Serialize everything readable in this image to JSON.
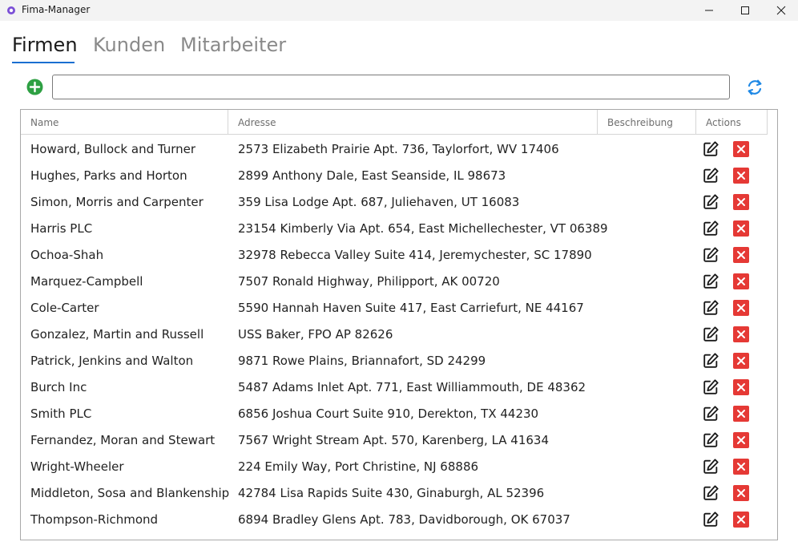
{
  "window": {
    "title": "Fima-Manager",
    "controls": [
      "minimize-icon",
      "maximize-icon",
      "close-icon"
    ]
  },
  "tabs": [
    {
      "label": "Firmen",
      "active": true
    },
    {
      "label": "Kunden",
      "active": false
    },
    {
      "label": "Mitarbeiter",
      "active": false
    }
  ],
  "toolbar": {
    "add_icon": "plus-circle-icon",
    "search_value": "",
    "refresh_icon": "refresh-icon"
  },
  "colors": {
    "accent": "#1a6fd1",
    "add": "#2ea043",
    "delete": "#e53935",
    "refresh": "#1e88e5"
  },
  "table": {
    "columns": [
      "Name",
      "Adresse",
      "Beschreibung",
      "Actions"
    ],
    "rows": [
      {
        "name": "Howard, Bullock and Turner",
        "address": "2573 Elizabeth Prairie Apt. 736, Taylorfort, WV 17406",
        "description": ""
      },
      {
        "name": "Hughes, Parks and Horton",
        "address": "2899 Anthony Dale, East Seanside, IL 98673",
        "description": ""
      },
      {
        "name": "Simon, Morris and Carpenter",
        "address": "359 Lisa Lodge Apt. 687, Juliehaven, UT 16083",
        "description": ""
      },
      {
        "name": "Harris PLC",
        "address": "23154 Kimberly Via Apt. 654, East Michellechester, VT 06389",
        "description": ""
      },
      {
        "name": "Ochoa-Shah",
        "address": "32978 Rebecca Valley Suite 414, Jeremychester, SC 17890",
        "description": ""
      },
      {
        "name": "Marquez-Campbell",
        "address": "7507 Ronald Highway, Philipport, AK 00720",
        "description": ""
      },
      {
        "name": "Cole-Carter",
        "address": "5590 Hannah Haven Suite 417, East Carriefurt, NE 44167",
        "description": ""
      },
      {
        "name": "Gonzalez, Martin and Russell",
        "address": "USS Baker, FPO AP 82626",
        "description": ""
      },
      {
        "name": "Patrick, Jenkins and Walton",
        "address": "9871 Rowe Plains, Briannafort, SD 24299",
        "description": ""
      },
      {
        "name": "Burch Inc",
        "address": "5487 Adams Inlet Apt. 771, East Williammouth, DE 48362",
        "description": ""
      },
      {
        "name": "Smith PLC",
        "address": "6856 Joshua Court Suite 910, Derekton, TX 44230",
        "description": ""
      },
      {
        "name": "Fernandez, Moran and Stewart",
        "address": "7567 Wright Stream Apt. 570, Karenberg, LA 41634",
        "description": ""
      },
      {
        "name": "Wright-Wheeler",
        "address": "224 Emily Way, Port Christine, NJ 68886",
        "description": ""
      },
      {
        "name": "Middleton, Sosa and Blankenship",
        "address": "42784 Lisa Rapids Suite 430, Ginaburgh, AL 52396",
        "description": ""
      },
      {
        "name": "Thompson-Richmond",
        "address": "6894 Bradley Glens Apt. 783, Davidborough, OK 67037",
        "description": ""
      }
    ],
    "row_action_icons": [
      "edit-icon",
      "delete-icon"
    ]
  }
}
